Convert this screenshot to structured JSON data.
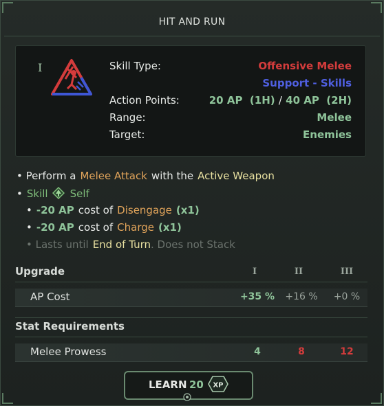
{
  "title": "HIT AND RUN",
  "tier_mark": "I",
  "icon": "melee-skill-icon",
  "info": {
    "skill_type_label": "Skill Type:",
    "skill_type_value": "Offensive Melee",
    "category_value": "Support - Skills",
    "ap_label": "Action Points:",
    "ap_value_1": "20 AP",
    "ap_note_1": "(1H)",
    "ap_sep": "/",
    "ap_value_2": "40 AP",
    "ap_note_2": "(2H)",
    "range_label": "Range:",
    "range_value": "Melee",
    "target_label": "Target:",
    "target_value": "Enemies"
  },
  "desc": {
    "l1_a": "• Perform a",
    "l1_b": "Melee Attack",
    "l1_c": "with the",
    "l1_d": "Active Weapon",
    "l2_a": "•",
    "l2_b": "Skill",
    "l2_c": "Self",
    "l3_a": "•",
    "l3_b": "-20 AP",
    "l3_c": "cost of",
    "l3_d": "Disengage",
    "l3_e": "(x1)",
    "l4_a": "•",
    "l4_b": "-20 AP",
    "l4_c": "cost of",
    "l4_d": "Charge",
    "l4_e": "(x1)",
    "l5_a": "• Lasts until",
    "l5_b": "End of Turn",
    "l5_c": ". Does not Stack"
  },
  "upgrade": {
    "header": "Upgrade",
    "tiers": [
      "I",
      "II",
      "III"
    ],
    "row_label": "AP Cost",
    "values": [
      "+35 %",
      "+16 %",
      "+0 %"
    ]
  },
  "requirements": {
    "header": "Stat Requirements",
    "row_label": "Melee Prowess",
    "values": [
      "4",
      "8",
      "12"
    ]
  },
  "learn": {
    "label": "LEARN",
    "cost": "20",
    "unit": "XP"
  },
  "colors": {
    "red": "#d43c3c",
    "blue": "#4f5fe0",
    "green": "#8fc49a",
    "orange": "#e0a35a"
  }
}
